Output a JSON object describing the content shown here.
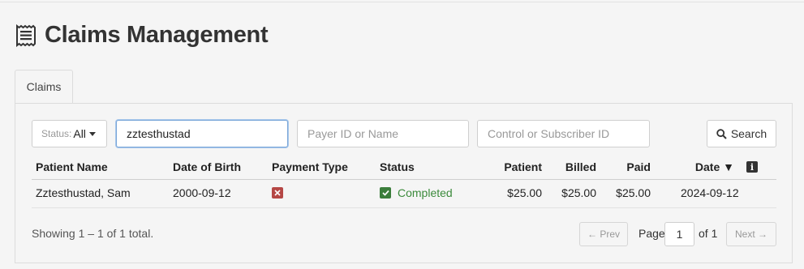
{
  "page": {
    "title": "Claims Management",
    "title_icon": "receipt-icon"
  },
  "tabs": [
    {
      "label": "Claims",
      "active": true
    }
  ],
  "filters": {
    "status_prefix": "Status:",
    "status_value": "All",
    "patient_value": "zztesthustad",
    "payer_placeholder": "Payer ID or Name",
    "control_placeholder": "Control or Subscriber ID",
    "search_label": "Search"
  },
  "table": {
    "headers": {
      "patient_name": "Patient Name",
      "dob": "Date of Birth",
      "payment_type": "Payment Type",
      "status": "Status",
      "patient": "Patient",
      "billed": "Billed",
      "paid": "Paid",
      "date": "Date ▼",
      "info": "i"
    },
    "rows": [
      {
        "patient_name": "Zztesthustad, Sam",
        "dob": "2000-09-12",
        "payment_type_icon": "x-icon",
        "status_icon": "check-icon",
        "status": "Completed",
        "patient": "$25.00",
        "billed": "$25.00",
        "paid": "$25.00",
        "date": "2024-09-12"
      }
    ]
  },
  "footer": {
    "showing": "Showing 1 – 1 of 1 total.",
    "prev": "← Prev",
    "page_label": "Page",
    "page_value": "1",
    "of_label": "of 1",
    "next": "Next →"
  },
  "colors": {
    "completed": "#3b8a3b",
    "cancel": "#b54745",
    "focus": "#7aa6d8"
  }
}
